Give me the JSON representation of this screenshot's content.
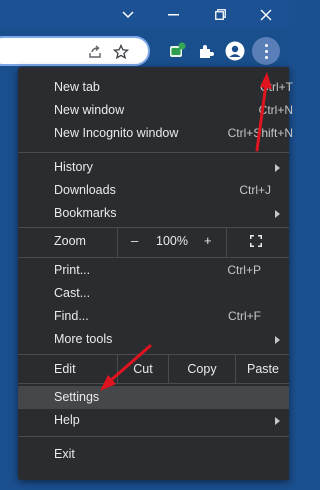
{
  "window_controls": {
    "tab_search_icon": "chevron-down",
    "minimize_icon": "minimize",
    "restore_icon": "restore",
    "close_icon": "close"
  },
  "toolbar": {
    "share_icon": "share",
    "bookmark_icon": "star",
    "extension_icon_1": "green-extension",
    "extensions_icon": "puzzle",
    "profile_icon": "person",
    "menu_icon": "three-dots-vertical"
  },
  "menu": {
    "group1": [
      {
        "label": "New tab",
        "shortcut": "Ctrl+T"
      },
      {
        "label": "New window",
        "shortcut": "Ctrl+N"
      },
      {
        "label": "New Incognito window",
        "shortcut": "Ctrl+Shift+N"
      }
    ],
    "group2": [
      {
        "label": "History",
        "shortcut": ""
      },
      {
        "label": "Downloads",
        "shortcut": "Ctrl+J"
      },
      {
        "label": "Bookmarks",
        "shortcut": ""
      }
    ],
    "zoom": {
      "label": "Zoom",
      "minus": "–",
      "value": "100%",
      "plus": "+"
    },
    "group3": [
      {
        "label": "Print...",
        "shortcut": "Ctrl+P"
      },
      {
        "label": "Cast...",
        "shortcut": ""
      },
      {
        "label": "Find...",
        "shortcut": "Ctrl+F"
      },
      {
        "label": "More tools",
        "shortcut": ""
      }
    ],
    "edit": {
      "label": "Edit",
      "cut": "Cut",
      "copy": "Copy",
      "paste": "Paste"
    },
    "group4": [
      {
        "label": "Settings"
      },
      {
        "label": "Help"
      }
    ],
    "exit": {
      "label": "Exit"
    }
  },
  "colors": {
    "annotation_arrow": "#e0141e",
    "menu_bg": "#2b2c2f",
    "titlebar_bg": "#1c5193"
  }
}
